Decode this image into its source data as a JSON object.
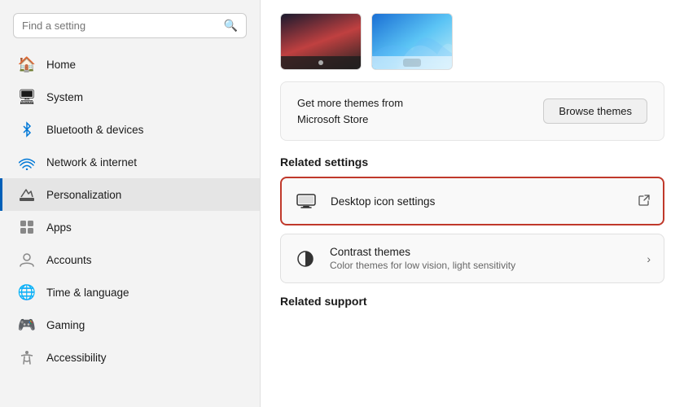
{
  "sidebar": {
    "search": {
      "placeholder": "Find a setting",
      "value": ""
    },
    "nav_items": [
      {
        "id": "home",
        "label": "Home",
        "icon": "🏠",
        "active": false
      },
      {
        "id": "system",
        "label": "System",
        "icon": "💻",
        "active": false
      },
      {
        "id": "bluetooth",
        "label": "Bluetooth & devices",
        "icon": "🔵",
        "active": false
      },
      {
        "id": "network",
        "label": "Network & internet",
        "icon": "🌐",
        "active": false
      },
      {
        "id": "personalization",
        "label": "Personalization",
        "icon": "✏️",
        "active": true
      },
      {
        "id": "apps",
        "label": "Apps",
        "icon": "📱",
        "active": false
      },
      {
        "id": "accounts",
        "label": "Accounts",
        "icon": "👤",
        "active": false
      },
      {
        "id": "time",
        "label": "Time & language",
        "icon": "🌐",
        "active": false
      },
      {
        "id": "gaming",
        "label": "Gaming",
        "icon": "🎮",
        "active": false
      },
      {
        "id": "accessibility",
        "label": "Accessibility",
        "icon": "♿",
        "active": false
      }
    ]
  },
  "main": {
    "get_more_themes": {
      "text_line1": "Get more themes from",
      "text_line2": "Microsoft Store",
      "button_label": "Browse themes"
    },
    "related_settings": {
      "section_title": "Related settings",
      "items": [
        {
          "id": "desktop-icon-settings",
          "title": "Desktop icon settings",
          "subtitle": "",
          "icon": "🖥",
          "has_external": true,
          "highlighted": true
        },
        {
          "id": "contrast-themes",
          "title": "Contrast themes",
          "subtitle": "Color themes for low vision, light sensitivity",
          "icon": "◑",
          "has_arrow": true,
          "highlighted": false
        }
      ]
    },
    "related_support": {
      "section_title": "Related support"
    }
  }
}
